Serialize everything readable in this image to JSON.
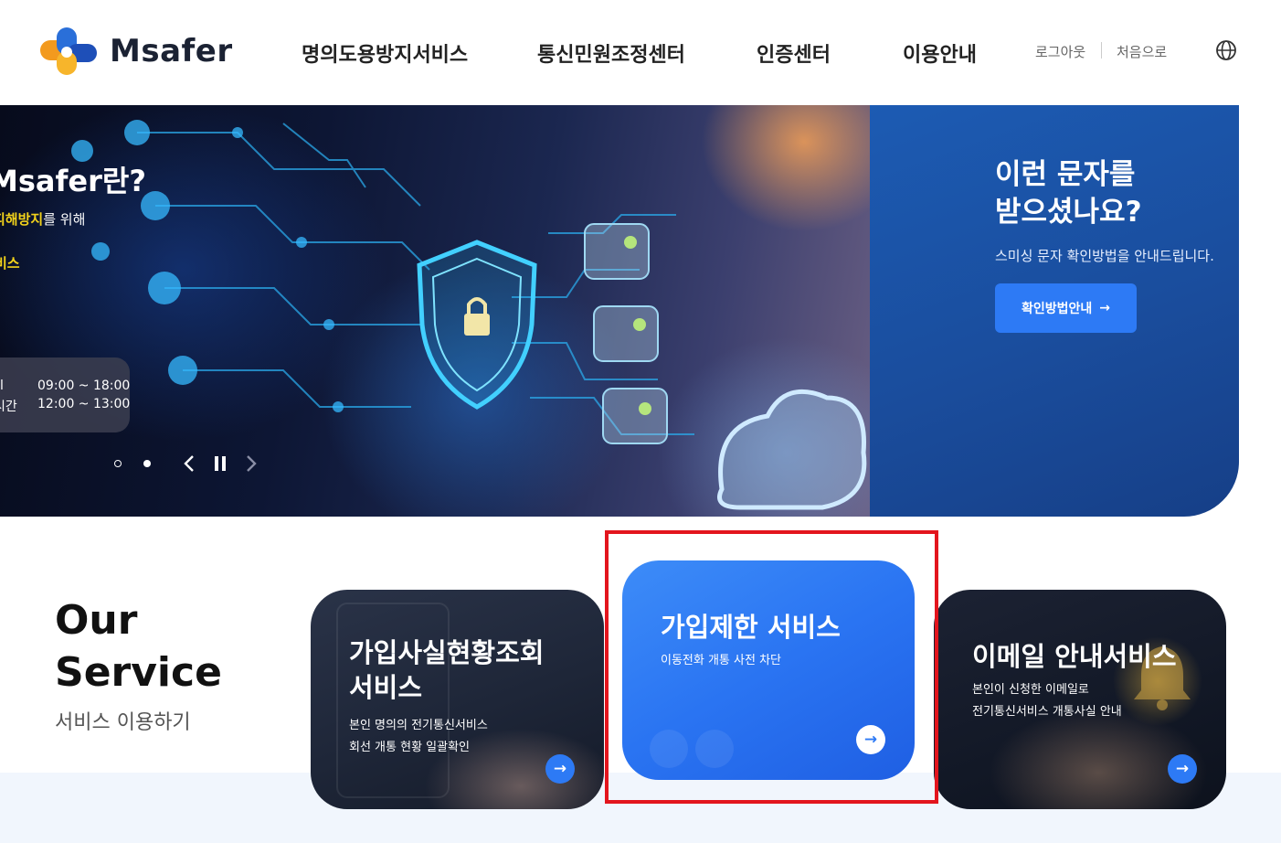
{
  "header": {
    "logo_text": "Msafer",
    "nav": [
      {
        "label": "명의도용방지서비스"
      },
      {
        "label": "통신민원조정센터"
      },
      {
        "label": "인증센터"
      },
      {
        "label": "이용안내"
      }
    ],
    "util": {
      "logout": "로그아웃",
      "home": "처음으로"
    },
    "language_icon": "globe-icon"
  },
  "hero": {
    "slide": {
      "title": "Msafer란?",
      "sub_highlight": "피해방지",
      "sub_rest": "를 위해",
      "sub2": "비스",
      "hours": [
        {
          "label": "l",
          "value": "09:00 ~ 18:00"
        },
        {
          "label": "시간",
          "value": "12:00 ~ 13:00"
        }
      ]
    },
    "controls": {
      "prev_icon": "chevron-left-icon",
      "pause_icon": "pause-icon",
      "next_icon": "chevron-right-icon",
      "slide_count": 2,
      "active_slide": 2
    },
    "panel": {
      "title_line1": "이런 문자를",
      "title_line2": "받으셨나요?",
      "subtitle": "스미싱 문자 확인방법을 안내드립니다.",
      "button_label": "확인방법안내",
      "button_arrow": "→"
    }
  },
  "service": {
    "title_line1": "Our",
    "title_line2": "Service",
    "subtitle": "서비스 이용하기",
    "cards": [
      {
        "title_line1": "가입사실현황조회",
        "title_line2": "서비스",
        "desc_line1": "본인 명의의 전기통신서비스",
        "desc_line2": "회선 개통 현황 일괄확인",
        "arrow": "→"
      },
      {
        "title": "가입제한 서비스",
        "desc": "이동전화 개통 사전 차단",
        "arrow": "→"
      },
      {
        "title": "이메일 안내서비스",
        "desc_line1": "본인이 신청한 이메일로",
        "desc_line2": "전기통신서비스 개통사실 안내",
        "arrow": "→"
      }
    ]
  },
  "colors": {
    "accent": "#2d7af5",
    "highlight_border": "#e3151d",
    "panel": "#1c5bb3",
    "band": "#f1f6fd"
  }
}
